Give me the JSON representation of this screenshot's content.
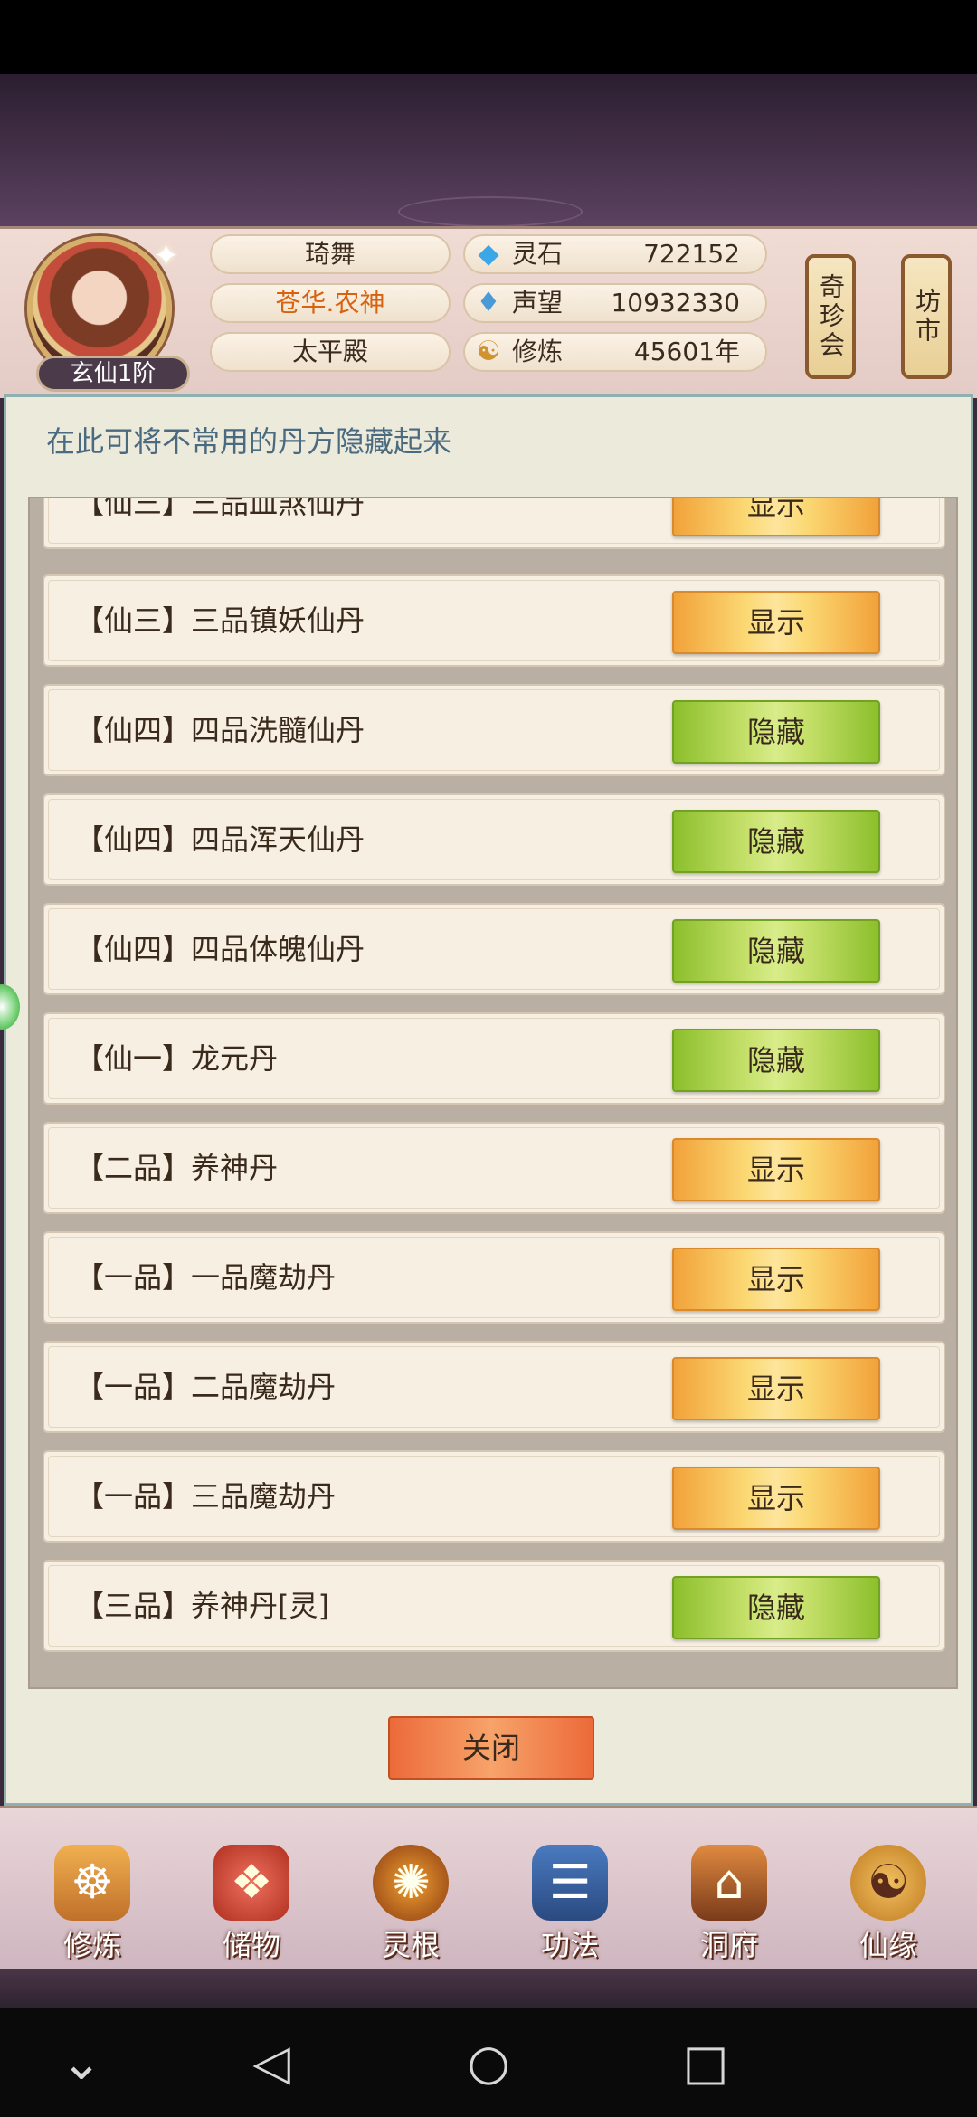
{
  "header": {
    "player_name": "琦舞",
    "title": "苍华.农神",
    "location": "太平殿",
    "rank": "玄仙1阶",
    "resources": [
      {
        "icon": "spirit-stone-icon",
        "label": "灵石",
        "value": "722152"
      },
      {
        "icon": "prestige-icon",
        "label": "声望",
        "value": "10932330"
      },
      {
        "icon": "cultivation-icon",
        "label": "修炼",
        "value": "45601年"
      }
    ],
    "shops": [
      {
        "label": "奇珍会"
      },
      {
        "label": "坊市"
      }
    ]
  },
  "panel": {
    "title": "在此可将不常用的丹方隐藏起来",
    "rows": [
      {
        "label": "【仙三】三品血煞仙丹",
        "action": "显示",
        "state": "show"
      },
      {
        "label": "【仙三】三品镇妖仙丹",
        "action": "显示",
        "state": "show"
      },
      {
        "label": "【仙四】四品洗髓仙丹",
        "action": "隐藏",
        "state": "hide"
      },
      {
        "label": "【仙四】四品浑天仙丹",
        "action": "隐藏",
        "state": "hide"
      },
      {
        "label": "【仙四】四品体魄仙丹",
        "action": "隐藏",
        "state": "hide"
      },
      {
        "label": "【仙一】龙元丹",
        "action": "隐藏",
        "state": "hide"
      },
      {
        "label": "【二品】养神丹",
        "action": "显示",
        "state": "show"
      },
      {
        "label": "【一品】一品魔劫丹",
        "action": "显示",
        "state": "show"
      },
      {
        "label": "【一品】二品魔劫丹",
        "action": "显示",
        "state": "show"
      },
      {
        "label": "【一品】三品魔劫丹",
        "action": "显示",
        "state": "show"
      },
      {
        "label": "【三品】养神丹[灵]",
        "action": "隐藏",
        "state": "hide"
      }
    ],
    "close_label": "关闭"
  },
  "nav": {
    "items": [
      {
        "label": "修炼",
        "icon": "cultivation-figure-icon"
      },
      {
        "label": "储物",
        "icon": "storage-bag-icon"
      },
      {
        "label": "灵根",
        "icon": "spirit-root-icon"
      },
      {
        "label": "功法",
        "icon": "scripture-book-icon"
      },
      {
        "label": "洞府",
        "icon": "cave-dwelling-icon"
      },
      {
        "label": "仙缘",
        "icon": "gourd-icon"
      }
    ]
  },
  "system_nav": [
    "collapse",
    "back",
    "home",
    "recents"
  ]
}
